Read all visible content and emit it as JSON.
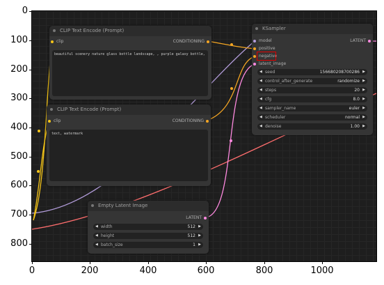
{
  "axes": {
    "y_ticks": [
      "0",
      "100",
      "200",
      "300",
      "400",
      "500",
      "600",
      "700",
      "800"
    ],
    "x_ticks": [
      "0",
      "200",
      "400",
      "600",
      "800",
      "1000"
    ]
  },
  "nodes": {
    "clip_pos": {
      "title": "CLIP Text Encode (Prompt)",
      "input": "clip",
      "output": "CONDITIONING",
      "text": "beautiful scenery nature glass bottle landscape, , purple galaxy bottle,"
    },
    "clip_neg": {
      "title": "CLIP Text Encode (Prompt)",
      "input": "clip",
      "output": "CONDITIONING",
      "text": "text, watermark"
    },
    "ksampler": {
      "title": "KSampler",
      "inputs": [
        "model",
        "positive",
        "negative",
        "latent_image"
      ],
      "output": "LATENT",
      "widgets": [
        {
          "name": "seed",
          "value": "156680208700286"
        },
        {
          "name": "control_after_generate",
          "value": "randomize"
        },
        {
          "name": "steps",
          "value": "20"
        },
        {
          "name": "cfg",
          "value": "8.0"
        },
        {
          "name": "sampler_name",
          "value": "euler"
        },
        {
          "name": "scheduler",
          "value": "normal"
        },
        {
          "name": "denoise",
          "value": "1.00"
        }
      ]
    },
    "latent": {
      "title": "Empty Latent Image",
      "output": "LATENT",
      "widgets": [
        {
          "name": "width",
          "value": "512"
        },
        {
          "name": "height",
          "value": "512"
        },
        {
          "name": "batch_size",
          "value": "1"
        }
      ]
    }
  },
  "colors": {
    "clip": "#f5c518",
    "conditioning": "#f5a623",
    "model": "#b39ddb",
    "latent": "#ff8ae0",
    "vae": "#ff6e6e",
    "highlight": "#e00000"
  }
}
